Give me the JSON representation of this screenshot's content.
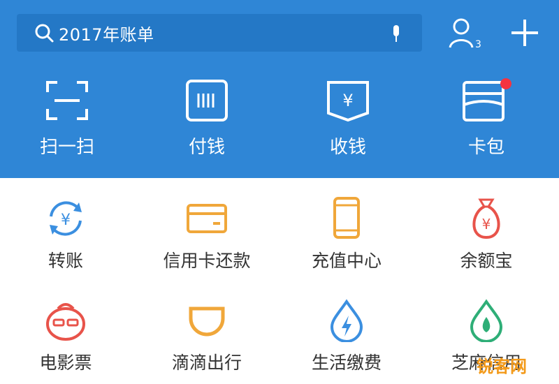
{
  "search": {
    "text": "2017年账单"
  },
  "header": {
    "contacts_badge": "3"
  },
  "actions": [
    {
      "label": "扫一扫",
      "icon": "scan-icon"
    },
    {
      "label": "付钱",
      "icon": "pay-code-icon"
    },
    {
      "label": "收钱",
      "icon": "receive-money-icon"
    },
    {
      "label": "卡包",
      "icon": "card-wallet-icon"
    }
  ],
  "grid": [
    {
      "label": "转账",
      "icon": "transfer-icon",
      "color": "#3b8fe0"
    },
    {
      "label": "信用卡还款",
      "icon": "credit-card-icon",
      "color": "#f0a73a"
    },
    {
      "label": "充值中心",
      "icon": "phone-recharge-icon",
      "color": "#f0a73a"
    },
    {
      "label": "余额宝",
      "icon": "money-bag-icon",
      "color": "#e8534a"
    },
    {
      "label": "电影票",
      "icon": "movie-ticket-icon",
      "color": "#e8534a"
    },
    {
      "label": "滴滴出行",
      "icon": "didi-icon",
      "color": "#f0a73a"
    },
    {
      "label": "生活缴费",
      "icon": "utility-payment-icon",
      "color": "#3b8fe0"
    },
    {
      "label": "芝麻信用",
      "icon": "sesame-credit-icon",
      "color": "#2eae77"
    }
  ],
  "colors": {
    "header_bg": "#2f86d6",
    "search_bg": "#2478c6",
    "badge_red": "#f5333f"
  },
  "watermark": {
    "text": "锐客网"
  }
}
